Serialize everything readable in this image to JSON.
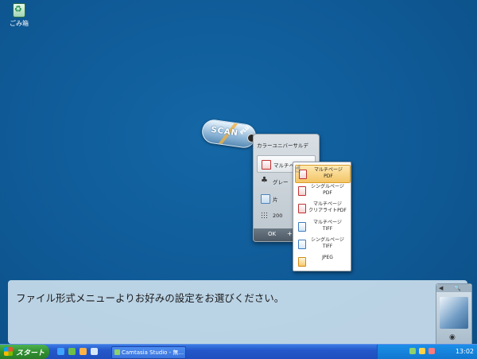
{
  "desktop": {
    "recycle_bin_label": "ごみ箱"
  },
  "scan_widget": {
    "badge_text": "SCAN",
    "badge_plus": "PLUS"
  },
  "menu": {
    "header": "カラーユニバーサルデ",
    "items": [
      {
        "label": "マルチページPDF",
        "icon": "pdf-icon"
      },
      {
        "label": "グレー",
        "icon": "clubs-icon"
      },
      {
        "label": "片",
        "icon": "image-icon"
      },
      {
        "label": "200",
        "icon": "dots-icon"
      }
    ],
    "ok_label": "OK",
    "plus_label": "+"
  },
  "submenu": {
    "items": [
      {
        "label": "マルチページ\nPDF",
        "icon": "pdf-icon",
        "selected": true
      },
      {
        "label": "シングルページ\nPDF",
        "icon": "pdf-icon",
        "selected": false
      },
      {
        "label": "マルチページ\nクリアライトPDF",
        "icon": "pdf-icon",
        "selected": false
      },
      {
        "label": "マルチページ\nTIFF",
        "icon": "tiff-icon",
        "selected": false
      },
      {
        "label": "シングルページ\nTIFF",
        "icon": "tiff-icon",
        "selected": false
      },
      {
        "label": "JPEG",
        "icon": "jpeg-icon",
        "selected": false
      }
    ]
  },
  "caption": {
    "text": "ファイル形式メニューよりお好みの設定をお選びください。"
  },
  "taskbar": {
    "start_label": "スタート",
    "task_button_label": "Camtasia Studio - 無...",
    "clock": "13:02"
  },
  "colors": {
    "desktop_bg": "#0f5a97",
    "selection": "#f3c566",
    "taskbar": "#2457c9"
  }
}
